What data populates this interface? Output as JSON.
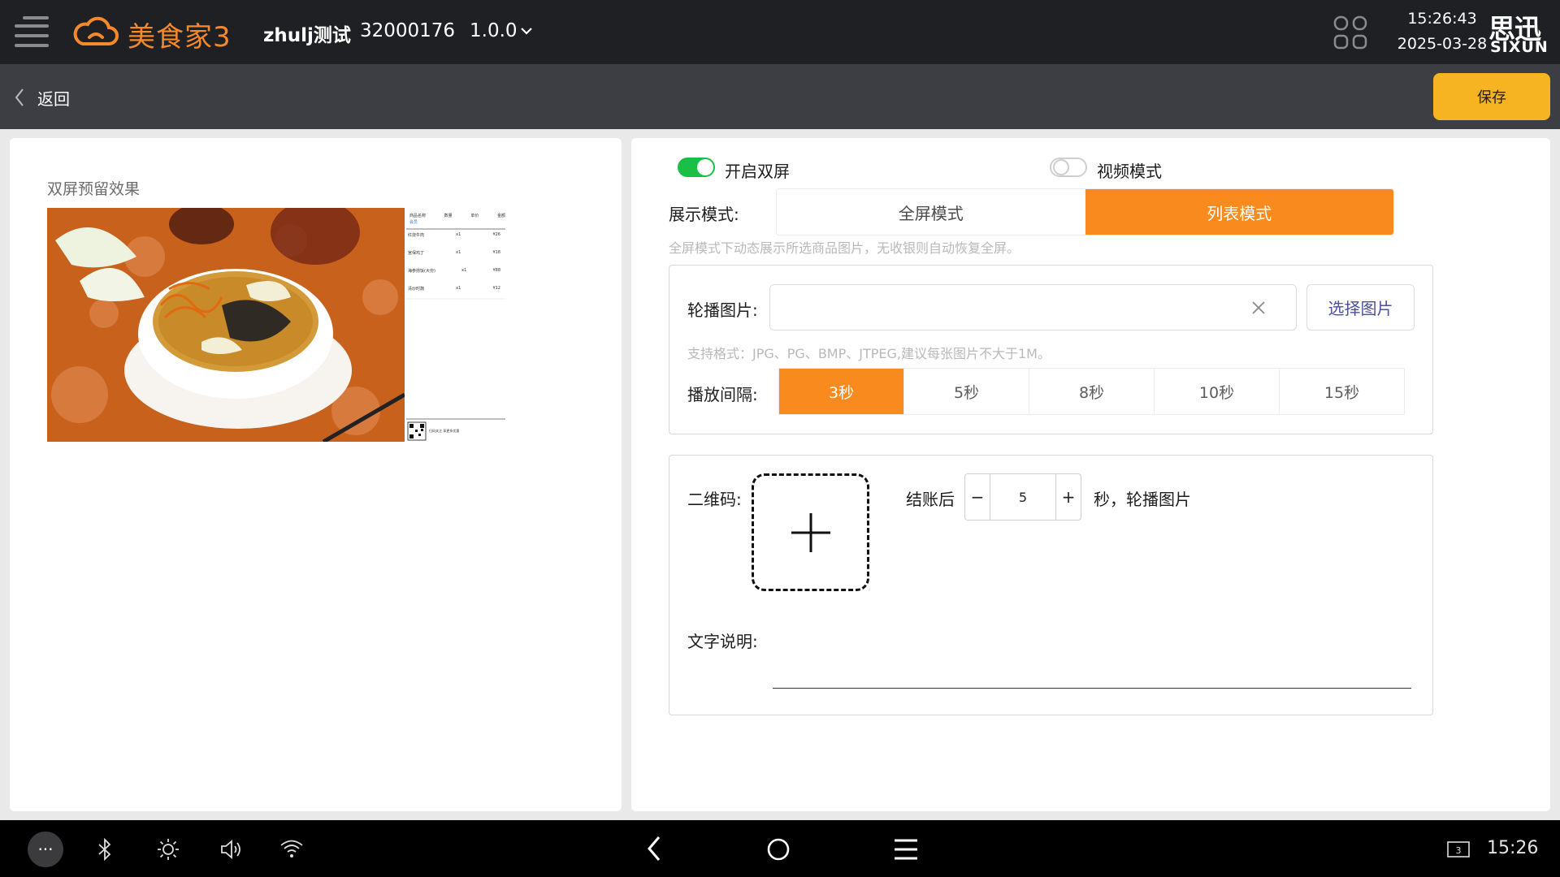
{
  "header": {
    "app_name": "美食家3",
    "store_name": "zhulj测试",
    "store_id": "32000176",
    "version": "1.0.0",
    "time": "15:26:43",
    "date": "2025-03-28",
    "brand_cn": "思迅",
    "brand_en": "SIXUN"
  },
  "subbar": {
    "back_label": "返回",
    "save_label": "保存"
  },
  "preview": {
    "title": "双屏预留效果",
    "mini_header": [
      "商品名称",
      "数量",
      "单价",
      "金额"
    ],
    "mini_rows": [
      [
        "会员",
        "",
        "",
        ""
      ],
      [
        "红烧牛肉",
        "x1",
        "¥26",
        "¥26"
      ],
      [
        "宫保鸡丁",
        "x1",
        "¥18",
        "¥18"
      ],
      [
        "海参捞饭(大份)",
        "x1",
        "¥88",
        "¥88"
      ],
      [
        "清炒时蔬",
        "x1",
        "¥12",
        "¥12"
      ]
    ],
    "mini_qr_text": "扫码关注 享更多优惠"
  },
  "settings": {
    "dual_screen_label": "开启双屏",
    "dual_screen_on": true,
    "video_mode_label": "视频模式",
    "video_mode_on": false,
    "display_mode_label": "展示模式:",
    "display_modes": [
      "全屏模式",
      "列表模式"
    ],
    "display_mode_selected": "列表模式",
    "display_mode_hint": "全屏模式下动态展示所选商品图片，无收银则自动恢复全屏。",
    "carousel_label": "轮播图片:",
    "carousel_value": "",
    "choose_image_label": "选择图片",
    "format_hint": "支持格式：JPG、PG、BMP、JTPEG,建议每张图片不大于1M。",
    "interval_label": "播放间隔:",
    "intervals": [
      "3秒",
      "5秒",
      "8秒",
      "10秒",
      "15秒"
    ],
    "interval_selected": "3秒",
    "qr_label": "二维码:",
    "after_checkout_label": "结账后",
    "after_checkout_value": "5",
    "stepper_minus": "−",
    "stepper_plus": "+",
    "after_checkout_suffix": "秒，轮播图片",
    "text_desc_label": "文字说明:",
    "text_desc_value": ""
  },
  "navbar": {
    "more_label": "···",
    "time": "15:26",
    "recent_badge": "3"
  },
  "colors": {
    "accent": "#f98a1d",
    "save": "#f6b422",
    "toggle_on": "#19c045",
    "topbar": "#1f2024"
  }
}
